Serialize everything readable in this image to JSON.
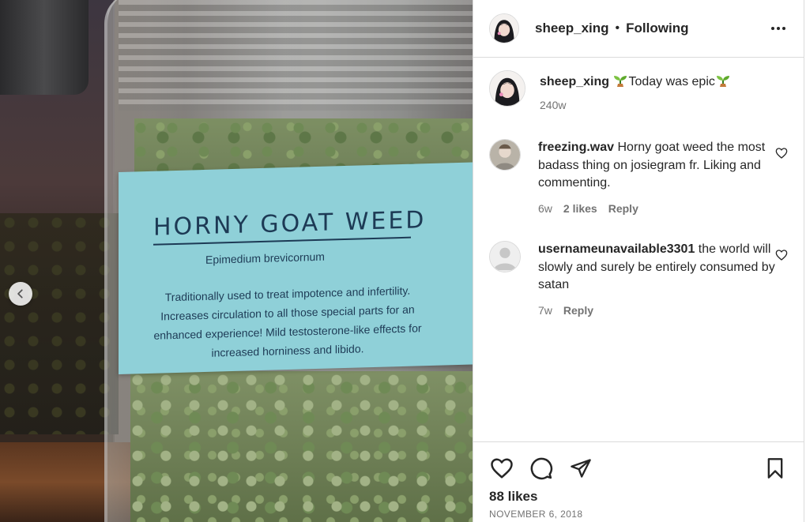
{
  "photo": {
    "label_title": "HORNY GOAT WEED",
    "label_subtitle": "Epimedium brevicornum",
    "label_description": "Traditionally used to treat impotence and infertility. Increases circulation to all those special parts for an enhanced experience! Mild testosterone-like effects for increased horniness and libido.",
    "prev_icon": "chevron-left-icon"
  },
  "header": {
    "username": "sheep_xing",
    "separator": "•",
    "follow_status": "Following",
    "more_icon": "more-horizontal-icon"
  },
  "caption": {
    "username": "sheep_xing",
    "text": "Today was epic",
    "emoji_icon": "sprout-icon",
    "age": "240w"
  },
  "comments": [
    {
      "username": "freezing.wav",
      "text": "Horny goat weed the most badass thing on josiegram fr. Liking and commenting.",
      "age": "6w",
      "likes": "2 likes",
      "reply_label": "Reply"
    },
    {
      "username": "usernameunavailable3301",
      "text": "the world will slowly and surely be entirely consumed by satan",
      "age": "7w",
      "reply_label": "Reply"
    }
  ],
  "footer": {
    "likes": "88 likes",
    "date": "NOVEMBER 6, 2018",
    "icons": [
      "heart-icon",
      "comment-icon",
      "share-icon",
      "bookmark-icon"
    ]
  },
  "colors": {
    "text": "#262626",
    "muted": "#737373",
    "border": "#dbdbdb",
    "label_bg": "#8fd0d8"
  }
}
